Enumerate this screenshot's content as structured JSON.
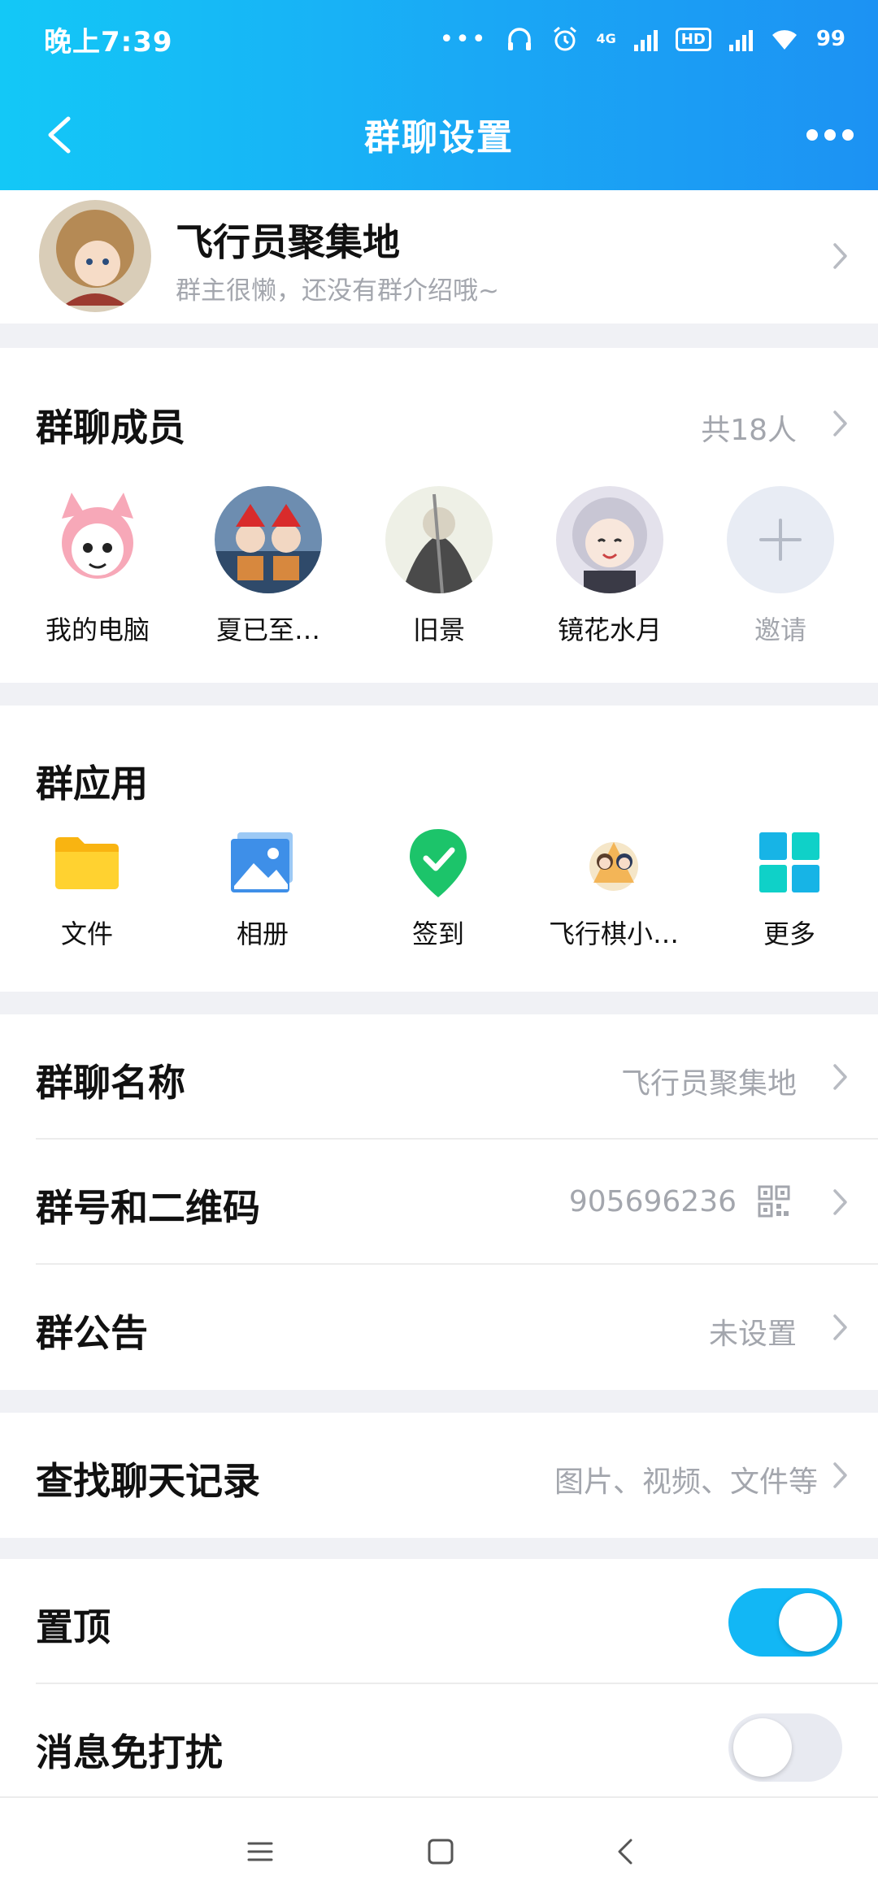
{
  "status_bar": {
    "time": "晚上7:39",
    "dots": "•••",
    "network_4g": "4G",
    "hd": "HD",
    "battery": "99"
  },
  "nav": {
    "title": "群聊设置"
  },
  "group": {
    "name": "飞行员聚集地",
    "intro": "群主很懒，还没有群介绍哦~"
  },
  "members": {
    "title": "群聊成员",
    "count": "共18人",
    "items": [
      {
        "name": "我的电脑"
      },
      {
        "name": "夏已至…"
      },
      {
        "name": "旧景"
      },
      {
        "name": "镜花水月"
      }
    ],
    "invite_label": "邀请"
  },
  "apps": {
    "title": "群应用",
    "items": [
      {
        "name": "文件",
        "icon": "folder-icon"
      },
      {
        "name": "相册",
        "icon": "album-icon"
      },
      {
        "name": "签到",
        "icon": "checkin-icon"
      },
      {
        "name": "飞行棋小…",
        "icon": "flight-chess-icon"
      },
      {
        "name": "更多",
        "icon": "more-apps-icon"
      }
    ]
  },
  "settings": {
    "group_name": {
      "label": "群聊名称",
      "value": "飞行员聚集地"
    },
    "group_number": {
      "label": "群号和二维码",
      "value": "905696236"
    },
    "announcement": {
      "label": "群公告",
      "value": "未设置"
    },
    "search_history": {
      "label": "查找聊天记录",
      "value": "图片、视频、文件等"
    },
    "pin_top": {
      "label": "置顶",
      "enabled": true
    },
    "do_not_disturb": {
      "label": "消息免打扰",
      "enabled": false
    }
  },
  "colors": {
    "accent": "#12b7f5",
    "header_start": "#13c8f7",
    "header_end": "#1c92f3",
    "secondary_text": "#a3a6ad"
  }
}
